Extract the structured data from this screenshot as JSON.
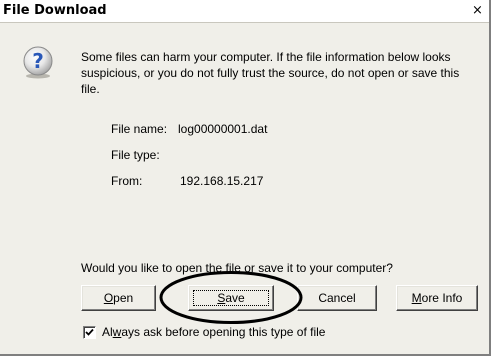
{
  "window": {
    "title": "File Download",
    "close_glyph": "×"
  },
  "message": {
    "icon": "question-icon",
    "warning": "Some files can harm your computer. If the file information below looks suspicious, or you do not fully trust the source, do not open or save this file."
  },
  "file_info": {
    "name_label": "File name:",
    "name_value": "log00000001.dat",
    "type_label": "File type:",
    "type_value": "",
    "from_label": "From:",
    "from_value": "192.168.15.217"
  },
  "prompt": "Would you like to open the file or save it to your computer?",
  "buttons": {
    "open_prefix": "",
    "open_accel": "O",
    "open_rest": "pen",
    "save_accel": "S",
    "save_rest": "ave",
    "cancel": "Cancel",
    "moreinfo_accel": "M",
    "moreinfo_rest": "ore Info"
  },
  "checkbox": {
    "checked": true,
    "label_pre": "Al",
    "label_accel": "w",
    "label_post": "ays ask before opening this type of file"
  },
  "colors": {
    "dialog_bg": "#f0efe9",
    "icon_blue": "#2a58b8",
    "annotation": "#000000"
  }
}
